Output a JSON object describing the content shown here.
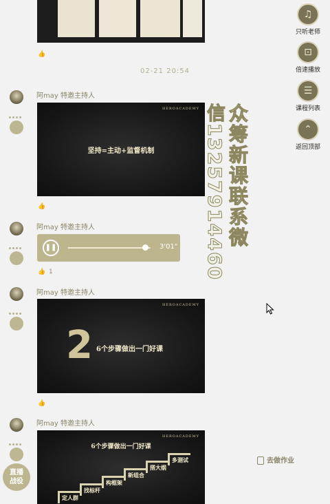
{
  "timestamp": "02-21 20:54",
  "sidebar": {
    "items": [
      {
        "label": "只听老师",
        "icon": "headphones-icon",
        "glyph": "♫"
      },
      {
        "label": "倍速播放",
        "icon": "speed-icon",
        "glyph": "⊡"
      },
      {
        "label": "课程列表",
        "icon": "list-icon",
        "glyph": "☰"
      },
      {
        "label": "返回顶部",
        "icon": "up-arrow-icon",
        "glyph": "⌃"
      }
    ]
  },
  "messages": [
    {
      "author": "阿may",
      "role": "特邀主持人"
    },
    {
      "author": "阿may",
      "role": "特邀主持人"
    },
    {
      "author": "阿may",
      "role": "特邀主持人"
    },
    {
      "author": "阿may",
      "role": "特邀主持人"
    }
  ],
  "slides": {
    "slide1_title": "坚持=主动+监督机制",
    "slide2_number": "2",
    "slide2_title": "6个步骤做出一门好课",
    "slide3_title": "6个步骤做出一门好课",
    "slide3_steps": [
      "定人群",
      "找标杆",
      "构框架",
      "新组合",
      "搭大纲",
      "多测试"
    ]
  },
  "audio": {
    "duration": "3'01\"",
    "progress": 0.93,
    "like_count": "1"
  },
  "watermark": {
    "line1": "众筹新课联系微",
    "line2": "信13257914460"
  },
  "homework_label": "去做作业",
  "live_badge": {
    "line1": "直播",
    "line2": "战役"
  },
  "colors": {
    "accent": "#bdb58e",
    "dark_slide": "#151515",
    "gold_text": "#e3d9a9"
  }
}
